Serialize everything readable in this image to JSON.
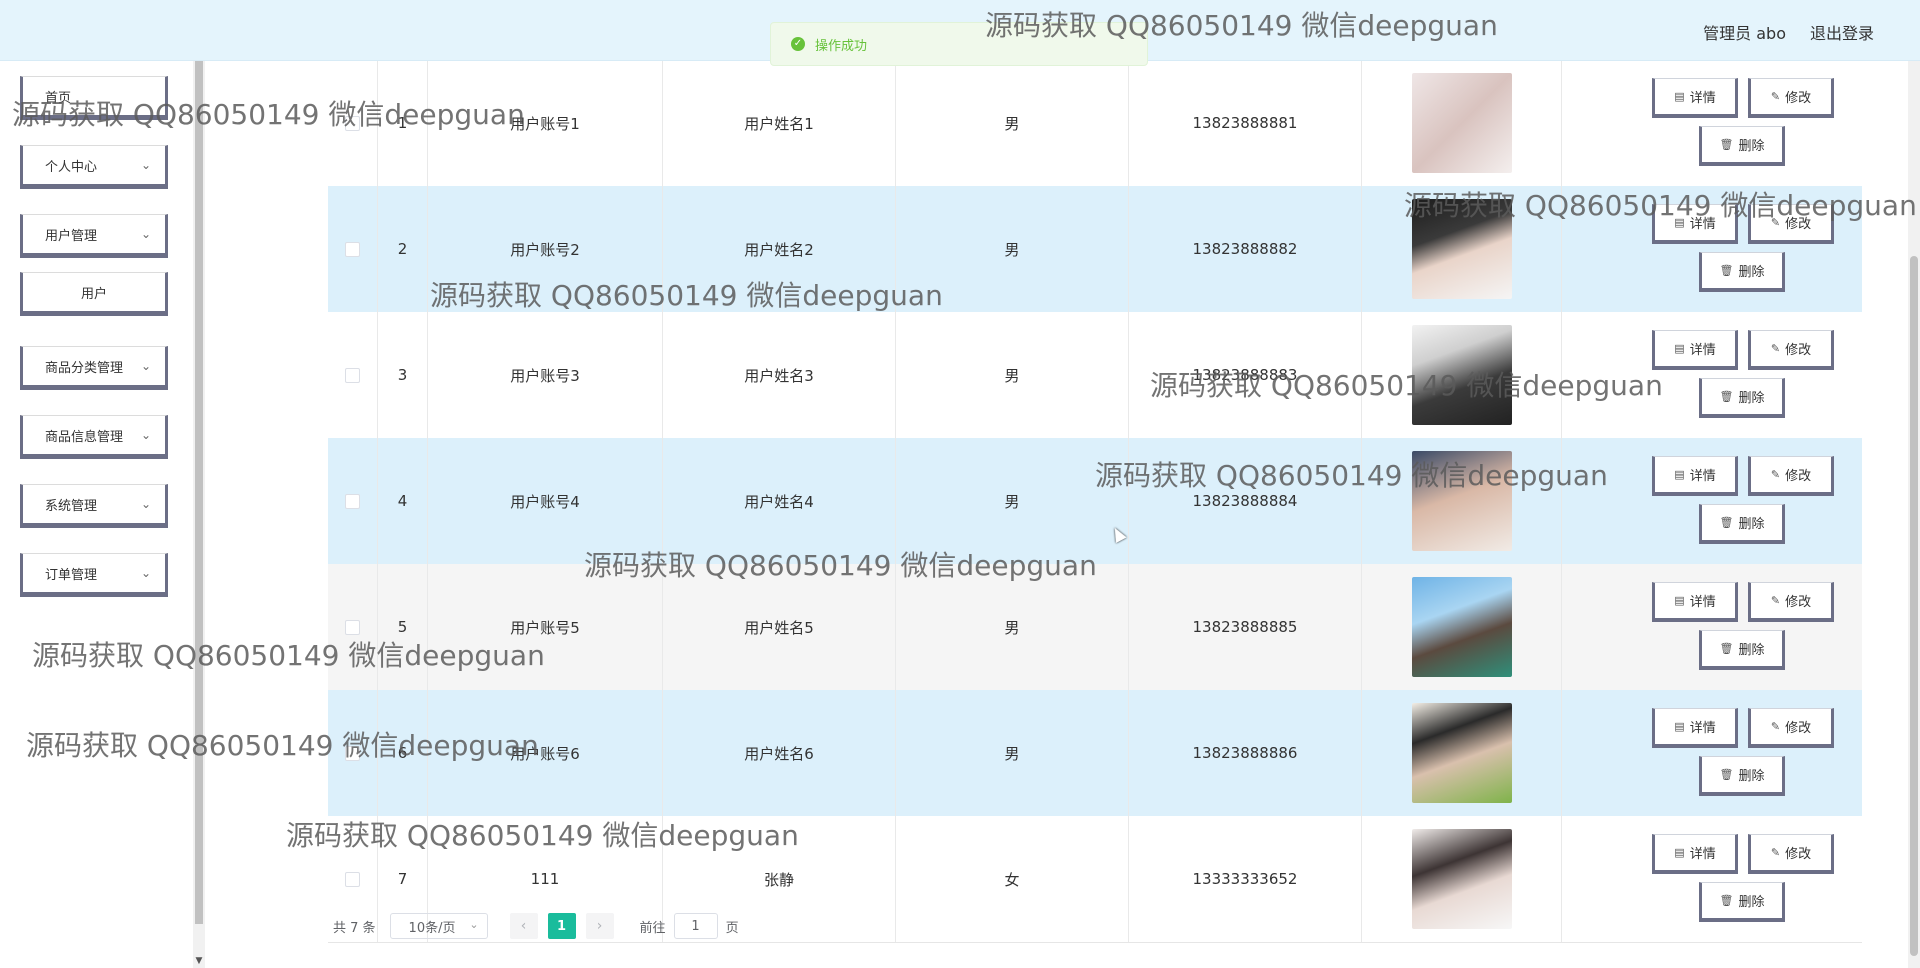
{
  "header": {
    "title": "",
    "admin_label": "管理员 abo",
    "logout": "退出登录"
  },
  "toast": {
    "text": "操作成功",
    "icon": "check-circle-icon"
  },
  "sidebar": {
    "items": [
      {
        "label": "首页",
        "has_chevron": false
      },
      {
        "label": "个人中心",
        "has_chevron": true
      },
      {
        "label": "用户管理",
        "has_chevron": true
      },
      {
        "label": "用户",
        "has_chevron": false,
        "sub": true
      },
      {
        "label": "商品分类管理",
        "has_chevron": true
      },
      {
        "label": "商品信息管理",
        "has_chevron": true
      },
      {
        "label": "系统管理",
        "has_chevron": true
      },
      {
        "label": "订单管理",
        "has_chevron": true
      }
    ]
  },
  "table": {
    "rows": [
      {
        "index": "1",
        "account": "用户账号1",
        "name": "用户姓名1",
        "gender": "男",
        "phone": "13823888881"
      },
      {
        "index": "2",
        "account": "用户账号2",
        "name": "用户姓名2",
        "gender": "男",
        "phone": "13823888882"
      },
      {
        "index": "3",
        "account": "用户账号3",
        "name": "用户姓名3",
        "gender": "男",
        "phone": "13823888883"
      },
      {
        "index": "4",
        "account": "用户账号4",
        "name": "用户姓名4",
        "gender": "男",
        "phone": "13823888884"
      },
      {
        "index": "5",
        "account": "用户账号5",
        "name": "用户姓名5",
        "gender": "男",
        "phone": "13823888885"
      },
      {
        "index": "6",
        "account": "用户账号6",
        "name": "用户姓名6",
        "gender": "男",
        "phone": "13823888886"
      },
      {
        "index": "7",
        "account": "111",
        "name": "张静",
        "gender": "女",
        "phone": "13333333652"
      }
    ],
    "actions": {
      "detail": "详情",
      "edit": "修改",
      "delete": "删除"
    }
  },
  "pagination": {
    "total": "共 7 条",
    "page_size": "10条/页",
    "current_page": "1",
    "goto_label": "前往",
    "goto_value": "1",
    "page_unit": "页"
  },
  "watermark": {
    "text": "源码获取 QQ86050149 微信deepguan"
  },
  "colors": {
    "header_bg": "#e4f4fc",
    "row_highlight": "#dcf0fb",
    "row_plain": "#ffffff",
    "row_gray": "#f5f5f5",
    "pager_active": "#1abc9c",
    "toast_green": "#67c23a",
    "button_border": "#6b6e86"
  }
}
